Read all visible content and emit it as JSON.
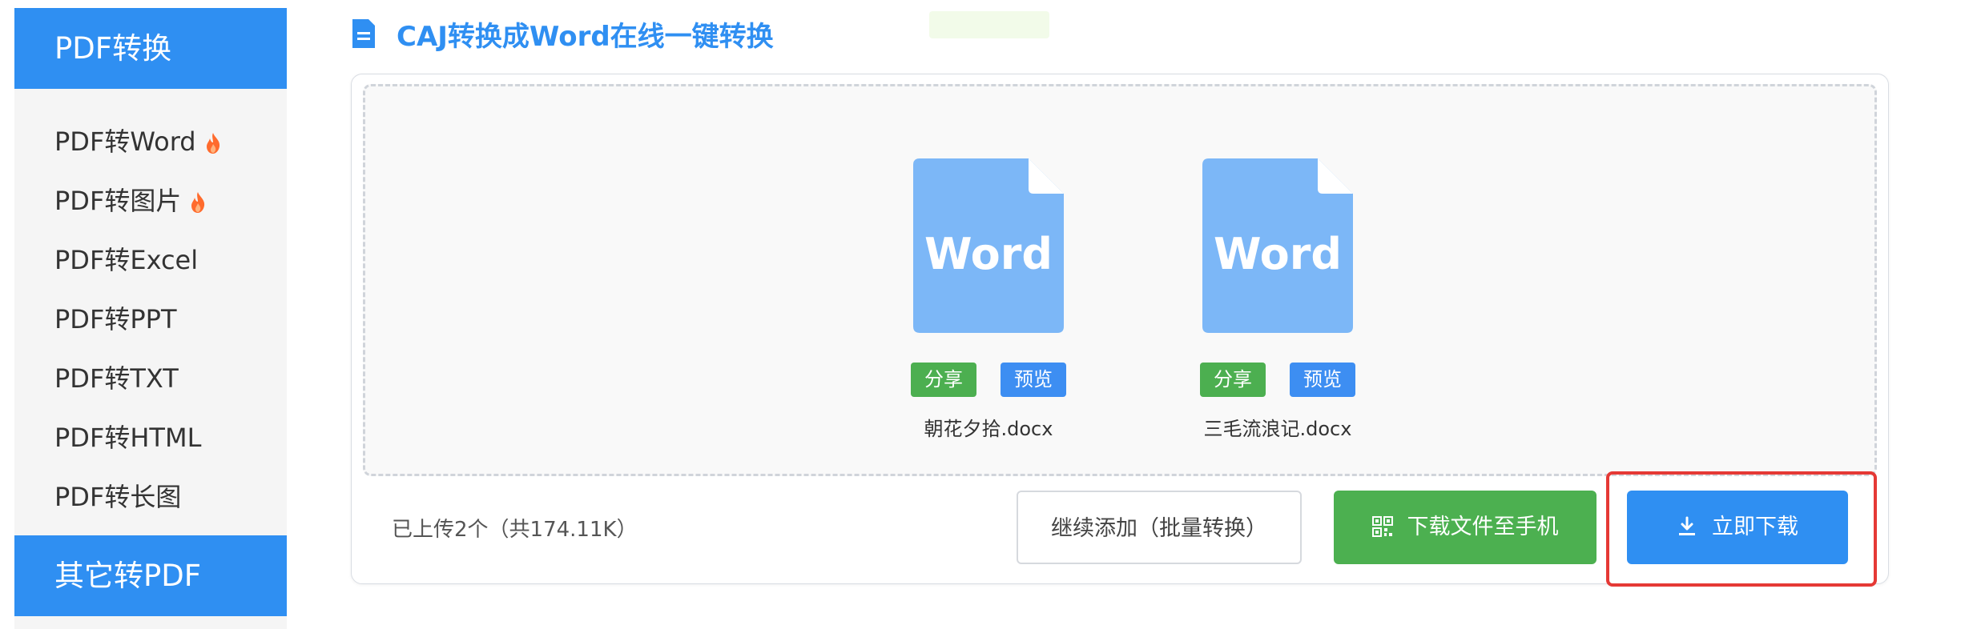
{
  "sidebar": {
    "header_top": "PDF转换",
    "items": [
      {
        "label": "PDF转Word",
        "hot": true
      },
      {
        "label": "PDF转图片",
        "hot": true
      },
      {
        "label": "PDF转Excel",
        "hot": false
      },
      {
        "label": "PDF转PPT",
        "hot": false
      },
      {
        "label": "PDF转TXT",
        "hot": false
      },
      {
        "label": "PDF转HTML",
        "hot": false
      },
      {
        "label": "PDF转长图",
        "hot": false
      }
    ],
    "header_bottom": "其它转PDF"
  },
  "main": {
    "title": "CAJ转换成Word在线一键转换",
    "files": [
      {
        "icon_text": "Word",
        "share_label": "分享",
        "preview_label": "预览",
        "name": "朝花夕拾.docx"
      },
      {
        "icon_text": "Word",
        "share_label": "分享",
        "preview_label": "预览",
        "name": "三毛流浪记.docx"
      }
    ],
    "upload_summary": "已上传2个（共174.11K）",
    "buttons": {
      "continue_label": "继续添加（批量转换）",
      "phone_label": "下载文件至手机",
      "download_label": "立即下载"
    }
  },
  "colors": {
    "primary": "#2f8ff2",
    "success": "#4caf50",
    "highlight": "#e53935",
    "word_icon": "#7cb7f7",
    "flame": "#ff6b2d"
  }
}
